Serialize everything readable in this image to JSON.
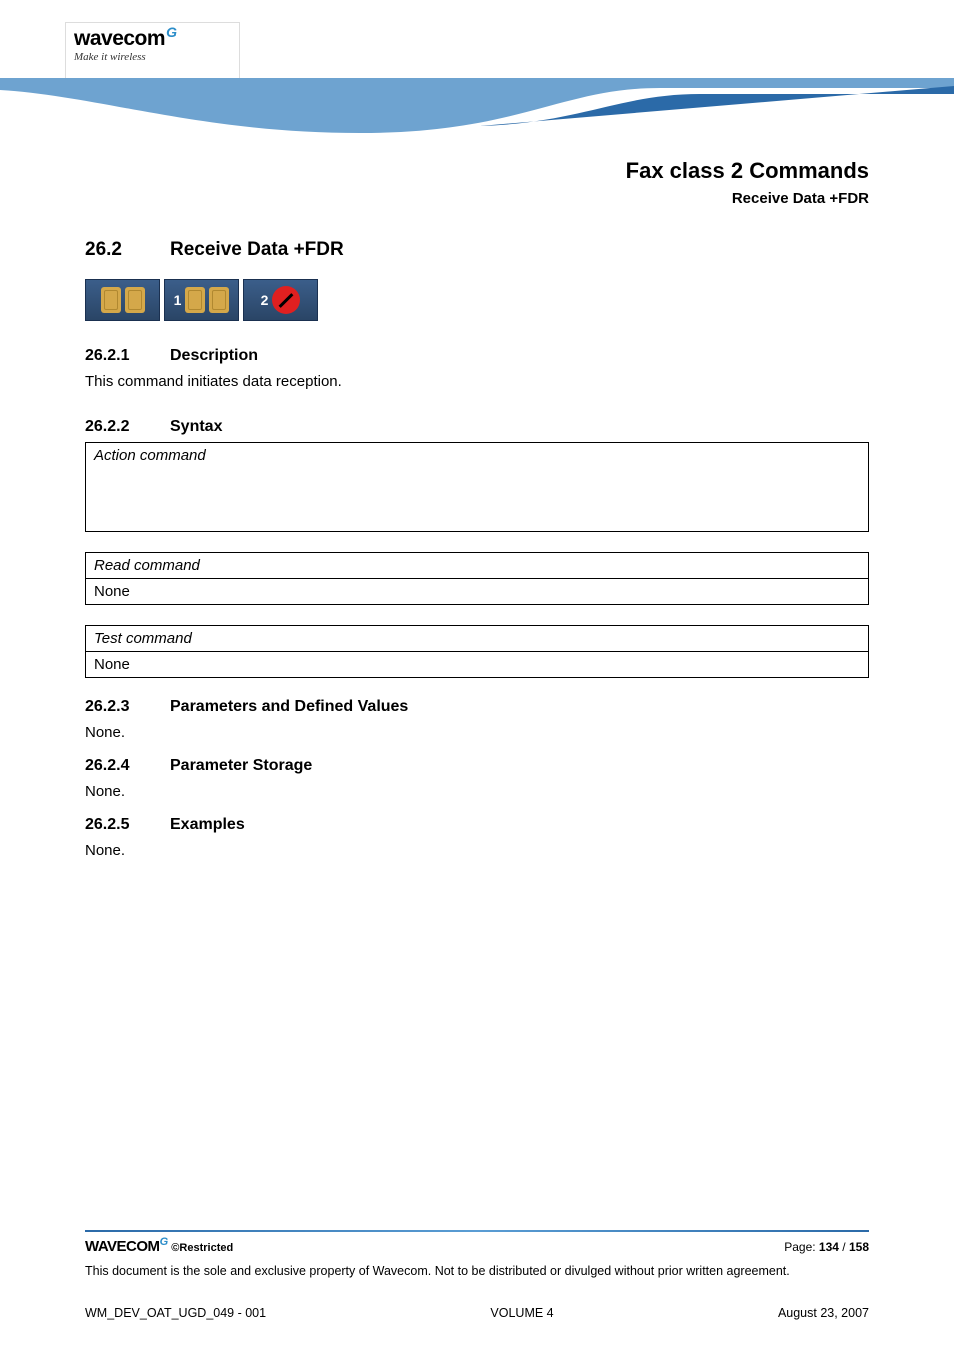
{
  "logo": {
    "name": "wavecom",
    "tagline": "Make it wireless"
  },
  "header": {
    "title": "Fax class 2 Commands",
    "subtitle": "Receive Data +FDR"
  },
  "section": {
    "number": "26.2",
    "title": "Receive Data +FDR",
    "badges": {
      "b1": "1",
      "b2": "2"
    }
  },
  "subs": {
    "desc": {
      "num": "26.2.1",
      "title": "Description",
      "text": "This command initiates data reception."
    },
    "syntax": {
      "num": "26.2.2",
      "title": "Syntax",
      "action_label": "Action command",
      "read_label": "Read command",
      "read_value": "None",
      "test_label": "Test command",
      "test_value": "None"
    },
    "params": {
      "num": "26.2.3",
      "title": "Parameters and Defined Values",
      "text": "None."
    },
    "storage": {
      "num": "26.2.4",
      "title": "Parameter Storage",
      "text": "None."
    },
    "examples": {
      "num": "26.2.5",
      "title": "Examples",
      "text": "None."
    }
  },
  "footer": {
    "logo": "WAVECOM",
    "restricted": "©Restricted",
    "page_label": "Page: ",
    "page_current": "134",
    "page_sep": " / ",
    "page_total": "158",
    "disclaimer": "This document is the sole and exclusive property of Wavecom. Not to be distributed or divulged without prior written agreement.",
    "docid": "WM_DEV_OAT_UGD_049 - 001",
    "volume": "VOLUME 4",
    "date": "August 23, 2007"
  }
}
